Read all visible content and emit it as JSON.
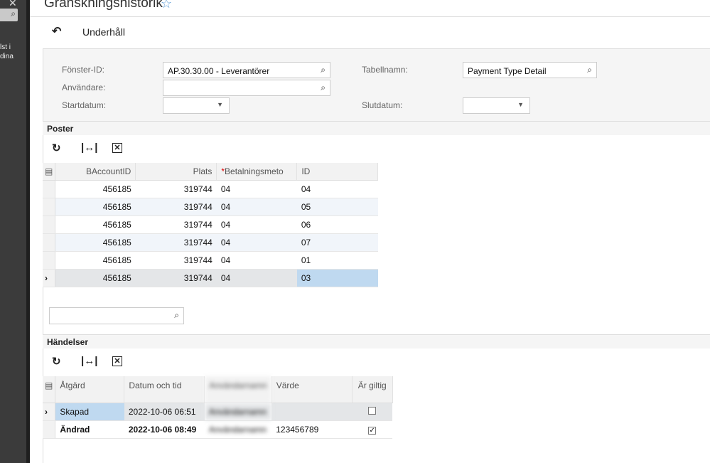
{
  "sidebar": {
    "close": "✕",
    "search": "⌕",
    "text_lines": [
      "lst i",
      "dina"
    ]
  },
  "header": {
    "title": "Granskningshistorik",
    "favorite": "☆"
  },
  "toolbar": {
    "undo": "↶",
    "title": "Underhåll"
  },
  "filters": {
    "window_id": {
      "label": "Fönster-ID:",
      "value": "AP.30.30.00 - Leverantörer"
    },
    "user": {
      "label": "Användare:",
      "value": ""
    },
    "start_date": {
      "label": "Startdatum:",
      "value": ""
    },
    "table_name": {
      "label": "Tabellnamn:",
      "value": "Payment Type Detail"
    },
    "end_date": {
      "label": "Slutdatum:",
      "value": ""
    }
  },
  "poster": {
    "title": "Poster",
    "columns": [
      "BAccountID",
      "Plats",
      "Betalningsmeto",
      "ID"
    ],
    "required_mark": "*",
    "rows": [
      [
        "456185",
        "319744",
        "04",
        "04"
      ],
      [
        "456185",
        "319744",
        "04",
        "05"
      ],
      [
        "456185",
        "319744",
        "04",
        "06"
      ],
      [
        "456185",
        "319744",
        "04",
        "07"
      ],
      [
        "456185",
        "319744",
        "04",
        "01"
      ],
      [
        "456185",
        "319744",
        "04",
        "03"
      ]
    ],
    "search_value": ""
  },
  "events": {
    "title": "Händelser",
    "columns": [
      "Åtgärd",
      "Datum och tid",
      "Användarnamn",
      "Värde",
      "Är giltig"
    ],
    "rows": [
      {
        "action": "Skapad",
        "datetime": "2022-10-06 06:51",
        "user": "Användarnamn",
        "value": "",
        "valid": false
      },
      {
        "action": "Ändrad",
        "datetime": "2022-10-06 08:49",
        "user": "Användarnamn",
        "value": "123456789",
        "valid": true
      }
    ]
  },
  "colors": {
    "accent": "#5b9bd5",
    "selected_cell": "#bfd9f0"
  }
}
